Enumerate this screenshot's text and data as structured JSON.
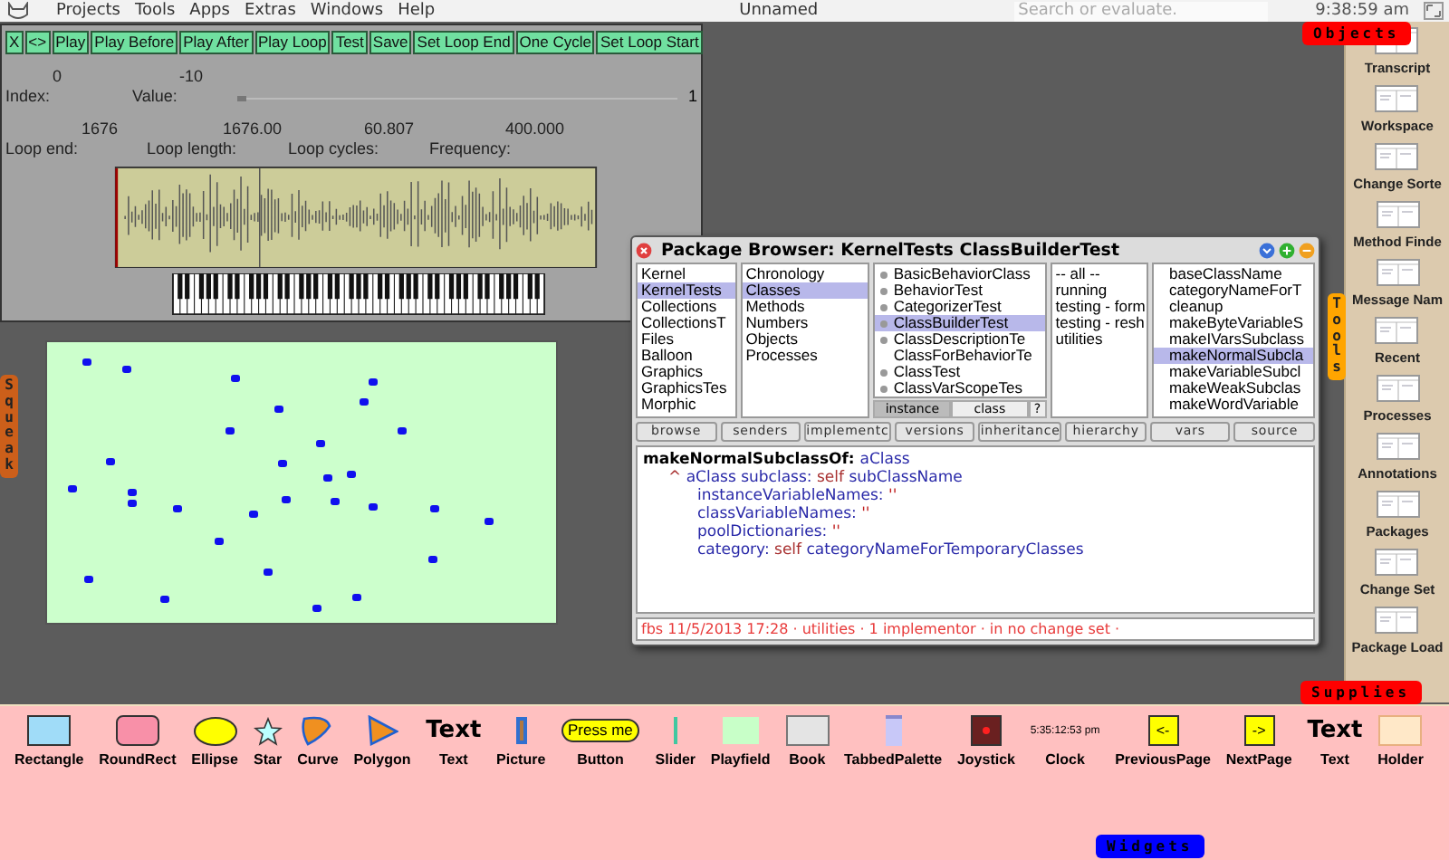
{
  "menu_bar": {
    "menus": [
      "Projects",
      "Tools",
      "Apps",
      "Extras",
      "Windows",
      "Help"
    ],
    "title": "Unnamed",
    "search": {
      "placeholder": "Search or evaluate."
    },
    "clock": "9:38:59 am"
  },
  "sound_editor": {
    "buttons": [
      "X",
      "<>",
      "Play",
      "Play Before",
      "Play After",
      "Play Loop",
      "Test",
      "Save",
      "Set Loop End",
      "One Cycle",
      "Set Loop Start"
    ],
    "fields": [
      {
        "label": "Index:",
        "value": "0"
      },
      {
        "label": "Value:",
        "value": "-10"
      }
    ],
    "slider": {
      "level": 0.01,
      "reading": "1"
    },
    "loop_fields": [
      {
        "label": "Loop end:",
        "value": "1676"
      },
      {
        "label": "Loop length:",
        "value": "1676.00"
      },
      {
        "label": "Loop cycles:",
        "value": "60.807"
      },
      {
        "label": "Frequency:",
        "value": "400.000"
      }
    ]
  },
  "squeak_tab": {
    "label": "Squeak"
  },
  "package_browser": {
    "title": "Package Browser: KernelTests ClassBuilderTest",
    "packages": [
      {
        "label": "Kernel",
        "selected": false
      },
      {
        "label": "KernelTests",
        "selected": true
      },
      {
        "label": "Collections",
        "selected": false
      },
      {
        "label": "CollectionsT",
        "selected": false
      },
      {
        "label": "Files",
        "selected": false
      },
      {
        "label": "Balloon",
        "selected": false
      },
      {
        "label": "Graphics",
        "selected": false
      },
      {
        "label": "GraphicsTes",
        "selected": false
      },
      {
        "label": "Morphic",
        "selected": false
      }
    ],
    "categories": [
      {
        "label": "Chronology",
        "selected": false
      },
      {
        "label": "Classes",
        "selected": true
      },
      {
        "label": "Methods",
        "selected": false
      },
      {
        "label": "Numbers",
        "selected": false
      },
      {
        "label": "Objects",
        "selected": false
      },
      {
        "label": "Processes",
        "selected": false
      }
    ],
    "classes": [
      {
        "label": "BasicBehaviorClass",
        "selected": false,
        "bullet": true
      },
      {
        "label": "BehaviorTest",
        "selected": false,
        "bullet": true
      },
      {
        "label": "CategorizerTest",
        "selected": false,
        "bullet": true
      },
      {
        "label": "ClassBuilderTest",
        "selected": true,
        "bullet": true
      },
      {
        "label": "ClassDescriptionTe",
        "selected": false,
        "bullet": true
      },
      {
        "label": "ClassForBehaviorTe",
        "selected": false,
        "bullet": false
      },
      {
        "label": "ClassTest",
        "selected": false,
        "bullet": true
      },
      {
        "label": "ClassVarScopeTes",
        "selected": false,
        "bullet": true
      }
    ],
    "side_toggle": [
      {
        "label": "instance",
        "selected": true
      },
      {
        "label": "class",
        "selected": false
      }
    ],
    "help_button": "?",
    "protocols": [
      {
        "label": "-- all --",
        "selected": false
      },
      {
        "label": "running",
        "selected": false
      },
      {
        "label": "testing - form",
        "selected": false
      },
      {
        "label": "testing - resh",
        "selected": false
      },
      {
        "label": "utilities",
        "selected": false
      }
    ],
    "methods": [
      {
        "label": "baseClassName",
        "selected": false
      },
      {
        "label": "categoryNameForT",
        "selected": false
      },
      {
        "label": "cleanup",
        "selected": false
      },
      {
        "label": "makeByteVariableS",
        "selected": false
      },
      {
        "label": "makeIVarsSubclass",
        "selected": false
      },
      {
        "label": "makeNormalSubcla",
        "selected": true
      },
      {
        "label": "makeVariableSubcl",
        "selected": false
      },
      {
        "label": "makeWeakSubclas",
        "selected": false
      },
      {
        "label": "makeWordVariable",
        "selected": false
      }
    ],
    "buttons": [
      "browse",
      "senders",
      "implementc",
      "versions",
      "inheritance",
      "hierarchy",
      "vars",
      "source"
    ],
    "code": [
      {
        "kind": "header",
        "tokens": [
          {
            "text": "makeNormalSubclassOf:",
            "kind": "selector"
          },
          {
            "text": "aClass",
            "kind": "arg"
          }
        ]
      },
      {
        "kind": "statement",
        "tokens": [
          {
            "text": "^",
            "kind": "self"
          },
          {
            "text": "aClass subclass:",
            "kind": "arg"
          },
          {
            "text": "self",
            "kind": "self"
          },
          {
            "text": "subClassName",
            "kind": "arg"
          }
        ]
      },
      {
        "kind": "continuation",
        "tokens": [
          {
            "text": "instanceVariableNames:",
            "kind": "arg"
          },
          {
            "text": "''",
            "kind": "literal"
          }
        ]
      },
      {
        "kind": "continuation",
        "tokens": [
          {
            "text": "classVariableNames:",
            "kind": "arg"
          },
          {
            "text": "''",
            "kind": "literal"
          }
        ]
      },
      {
        "kind": "continuation",
        "tokens": [
          {
            "text": "poolDictionaries:",
            "kind": "arg"
          },
          {
            "text": "''",
            "kind": "literal"
          }
        ]
      },
      {
        "kind": "continuation",
        "tokens": [
          {
            "text": "category:",
            "kind": "arg"
          },
          {
            "text": "self",
            "kind": "self"
          },
          {
            "text": "categoryNameForTemporaryClasses",
            "kind": "arg"
          }
        ]
      }
    ],
    "annotation": "fbs 11/5/2013 17:28 · utilities · 1 implementor · in no change set ·"
  },
  "objects_tab": {
    "label": "Objects"
  },
  "tools_tab": {
    "label": "Tools"
  },
  "tools_flap": {
    "items": [
      "Transcript",
      "Workspace",
      "Change Sorte",
      "Method Finde",
      "Message Nam",
      "Recent",
      "Processes",
      "Annotations",
      "Packages",
      "Change Set",
      "Package Load"
    ]
  },
  "supplies_tab": {
    "label": "Supplies"
  },
  "supplies_flap": {
    "items": [
      {
        "label": "Rectangle",
        "kind": "rectangle"
      },
      {
        "label": "RoundRect",
        "kind": "roundrect"
      },
      {
        "label": "Ellipse",
        "kind": "ellipse"
      },
      {
        "label": "Star",
        "kind": "star"
      },
      {
        "label": "Curve",
        "kind": "curve"
      },
      {
        "label": "Polygon",
        "kind": "polygon"
      },
      {
        "label": "Text",
        "kind": "text",
        "sample": "Text"
      },
      {
        "label": "Picture",
        "kind": "picture"
      },
      {
        "label": "Button",
        "kind": "button",
        "sample": "Press me"
      },
      {
        "label": "Slider",
        "kind": "slider"
      },
      {
        "label": "Playfield",
        "kind": "playfield"
      },
      {
        "label": "Book",
        "kind": "book"
      },
      {
        "label": "TabbedPalette",
        "kind": "tabbed"
      },
      {
        "label": "Joystick",
        "kind": "joystick"
      },
      {
        "label": "Clock",
        "kind": "clock",
        "sample": "5:35:12:53 pm"
      },
      {
        "label": "PreviousPage",
        "kind": "page",
        "sample": "<-"
      },
      {
        "label": "NextPage",
        "kind": "page",
        "sample": "->"
      },
      {
        "label": "Text",
        "kind": "text",
        "sample": "Text"
      },
      {
        "label": "Holder",
        "kind": "holder"
      }
    ]
  },
  "widgets_tab": {
    "label": "Widgets"
  }
}
